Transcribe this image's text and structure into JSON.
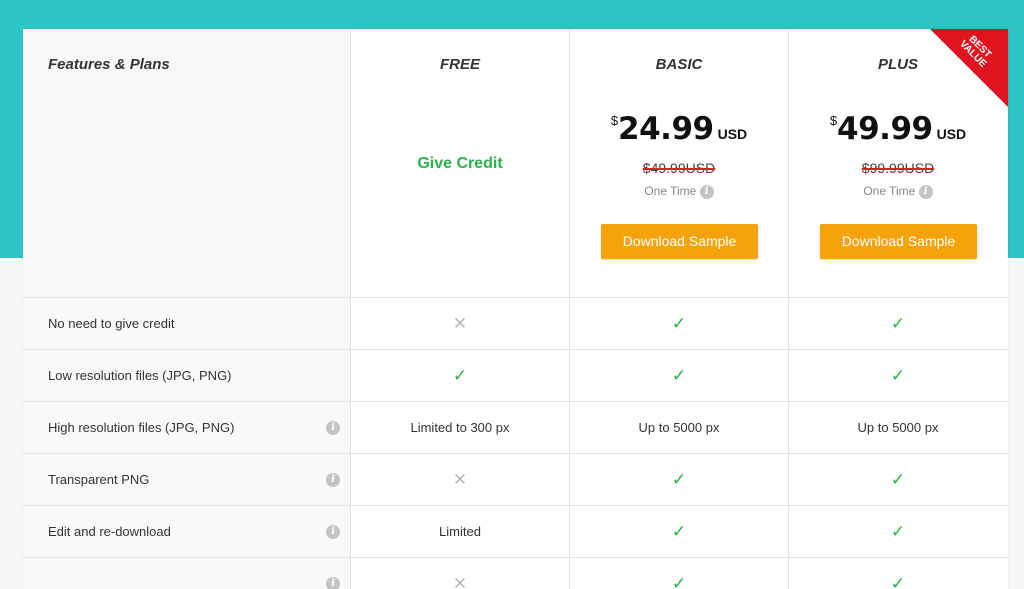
{
  "table": {
    "features_title": "Features & Plans",
    "plans": [
      {
        "name": "FREE",
        "offer": "Give Credit"
      },
      {
        "name": "BASIC",
        "currency_symbol": "$",
        "price": "24.99",
        "price_unit": "USD",
        "old_price": "$49.99USD",
        "billing": "One Time",
        "button_label": "Download Sample"
      },
      {
        "name": "PLUS",
        "currency_symbol": "$",
        "price": "49.99",
        "price_unit": "USD",
        "old_price": "$99.99USD",
        "billing": "One Time",
        "button_label": "Download Sample",
        "ribbon_line1": "BEST",
        "ribbon_line2": "VALUE"
      }
    ],
    "rows": [
      {
        "label": "No need to give credit",
        "info": false,
        "free": {
          "type": "cross"
        },
        "basic": {
          "type": "check"
        },
        "plus": {
          "type": "check"
        }
      },
      {
        "label": "Low resolution files (JPG, PNG)",
        "info": false,
        "free": {
          "type": "check"
        },
        "basic": {
          "type": "check"
        },
        "plus": {
          "type": "check"
        }
      },
      {
        "label": "High resolution files (JPG, PNG)",
        "info": true,
        "free": {
          "type": "text",
          "text": "Limited to 300 px"
        },
        "basic": {
          "type": "text",
          "text": "Up to 5000 px"
        },
        "plus": {
          "type": "text",
          "text": "Up to 5000 px"
        }
      },
      {
        "label": "Transparent PNG",
        "info": true,
        "free": {
          "type": "cross"
        },
        "basic": {
          "type": "check"
        },
        "plus": {
          "type": "check"
        }
      },
      {
        "label": "Edit and re-download",
        "info": true,
        "free": {
          "type": "text",
          "text": "Limited"
        },
        "basic": {
          "type": "check"
        },
        "plus": {
          "type": "check"
        }
      },
      {
        "label": "",
        "info": true,
        "free": {
          "type": "cross"
        },
        "basic": {
          "type": "check"
        },
        "plus": {
          "type": "check"
        }
      }
    ]
  },
  "icons": {
    "check": "✓",
    "cross": "✕",
    "info": "i"
  },
  "colors": {
    "background_band": "#2ec4c4",
    "accent_button": "#f5a30a",
    "check": "#25b048",
    "give_credit": "#2db14a",
    "strike": "#e02020",
    "ribbon": "#e0141e"
  }
}
